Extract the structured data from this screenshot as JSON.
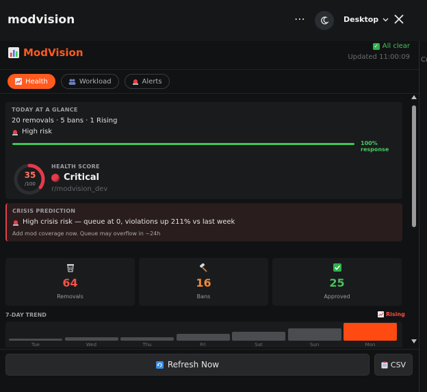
{
  "window": {
    "title": "modvision",
    "more_label": "⋯",
    "view_mode": "Desktop"
  },
  "background_fragment": "Cr",
  "header": {
    "brand": "ModVision",
    "status": "All clear",
    "updated": "Updated 11:00:09"
  },
  "tabs": [
    {
      "label": "Health",
      "icon": "chart-icon",
      "active": true
    },
    {
      "label": "Workload",
      "icon": "people-icon",
      "active": false
    },
    {
      "label": "Alerts",
      "icon": "siren-icon",
      "active": false
    }
  ],
  "glance": {
    "title": "TODAY AT A GLANCE",
    "summary": "20 removals · 5 bans · 1 Rising",
    "risk": "High risk",
    "response_label": "100% response",
    "response_fraction": 1.0
  },
  "health": {
    "title": "HEALTH SCORE",
    "score": "35",
    "max": "/100",
    "score_value": 35,
    "status": "Critical",
    "subreddit": "r/modvision_dev"
  },
  "crisis": {
    "title": "CRISIS PREDICTION",
    "message": "High crisis risk — queue at 0, violations up 211% vs last week",
    "advice": "Add mod coverage now. Queue may overflow in ~24h"
  },
  "stats": [
    {
      "icon": "wastebasket-icon",
      "value": "64",
      "label": "Removals",
      "color": "#f0524a"
    },
    {
      "icon": "hammer-icon",
      "value": "16",
      "label": "Bans",
      "color": "#f08a3a"
    },
    {
      "icon": "check-icon",
      "value": "25",
      "label": "Approved",
      "color": "#46c35c"
    }
  ],
  "trend": {
    "title": "7-DAY TREND",
    "tag": "Rising"
  },
  "chart_data": {
    "type": "bar",
    "categories": [
      "Tue",
      "Wed",
      "Thu",
      "Fri",
      "Sat",
      "Sun",
      "Mon"
    ],
    "values": [
      1,
      2,
      2,
      4,
      5,
      7,
      10
    ],
    "highlight": "Mon"
  },
  "footer": {
    "refresh": "Refresh Now",
    "csv": "CSV"
  },
  "colors": {
    "accent": "#ff5a1f",
    "ok": "#3cc85a",
    "danger": "#e6394a"
  }
}
